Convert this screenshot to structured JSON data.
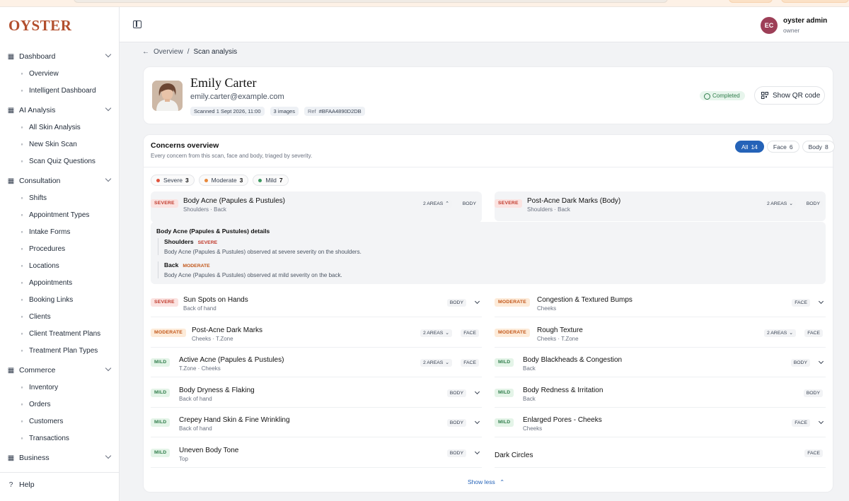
{
  "brand": {
    "logo": "OYSTER",
    "accent": "#b24f2e"
  },
  "sidebar": {
    "sections": [
      {
        "label": "Dashboard",
        "icon": "grid-icon",
        "items": [
          {
            "label": "Overview",
            "icon": "bar-chart-icon"
          },
          {
            "label": "Intelligent Dashboard",
            "icon": "circle-icon"
          }
        ]
      },
      {
        "label": "AI Analysis",
        "icon": "scan-icon",
        "items": [
          {
            "label": "All Skin Analysis",
            "icon": "scan-icon"
          },
          {
            "label": "New Skin Scan",
            "icon": "camera-icon"
          },
          {
            "label": "Scan Quiz Questions",
            "icon": "quiz-icon"
          }
        ]
      },
      {
        "label": "Consultation",
        "icon": "calendar-icon",
        "items": [
          {
            "label": "Shifts",
            "icon": "clock-icon"
          },
          {
            "label": "Appointment Types",
            "icon": "list-icon"
          },
          {
            "label": "Intake Forms",
            "icon": "form-icon"
          },
          {
            "label": "Procedures",
            "icon": "file-icon"
          },
          {
            "label": "Locations",
            "icon": "pin-icon"
          },
          {
            "label": "Appointments",
            "icon": "calendar-icon"
          },
          {
            "label": "Booking Links",
            "icon": "link-icon"
          },
          {
            "label": "Clients",
            "icon": "user-icon"
          },
          {
            "label": "Client Treatment Plans",
            "icon": "clipboard-icon"
          },
          {
            "label": "Treatment Plan Types",
            "icon": "list-icon"
          }
        ]
      },
      {
        "label": "Commerce",
        "icon": "cart-icon",
        "items": [
          {
            "label": "Inventory",
            "icon": "box-icon"
          },
          {
            "label": "Orders",
            "icon": "cart-icon"
          },
          {
            "label": "Customers",
            "icon": "users-icon"
          },
          {
            "label": "Transactions",
            "icon": "card-icon"
          }
        ]
      },
      {
        "label": "Business",
        "icon": "building-icon",
        "items": []
      }
    ],
    "help": "Help"
  },
  "header": {
    "avatar_initials": "EC",
    "user_name": "oyster admin",
    "user_role": "owner"
  },
  "breadcrumb": {
    "back": "Overview",
    "separator": "/",
    "current": "Scan analysis"
  },
  "patient": {
    "name": "Emily Carter",
    "email": "emily.carter@example.com",
    "scanned": "Scanned 1 Sept 2026, 11:00",
    "images": "3 images",
    "ref_label": "Ref",
    "ref": "#BFAA4890D2DB",
    "status": "Completed",
    "qr_button": "Show QR code"
  },
  "concerns": {
    "title": "Concerns overview",
    "subtitle": "Every concern from this scan, face and body, triaged by severity.",
    "tabs": [
      {
        "label": "All",
        "count": "14",
        "active": true
      },
      {
        "label": "Face",
        "count": "6",
        "active": false
      },
      {
        "label": "Body",
        "count": "8",
        "active": false
      }
    ],
    "filters": [
      {
        "label": "Severe",
        "count": "3",
        "color": "#e0533d"
      },
      {
        "label": "Moderate",
        "count": "3",
        "color": "#e8883a"
      },
      {
        "label": "Mild",
        "count": "7",
        "color": "#3c9a5f"
      }
    ],
    "rows": [
      {
        "badge": "SEVERE",
        "level": "severe",
        "name": "Body Acne (Papules & Pustules)",
        "sub": "Shoulders · Back",
        "areas": "2 AREAS",
        "tag": "BODY"
      },
      {
        "badge": "SEVERE",
        "level": "severe",
        "name": "Post-Acne Dark Marks (Body)",
        "sub": "Shoulders · Back",
        "areas": "2 AREAS",
        "tag": "BODY"
      },
      {
        "badge": "SEVERE",
        "level": "severe",
        "name": "Sun Spots on Hands",
        "sub": "Back of hand",
        "areas": "",
        "tag": "BODY"
      },
      {
        "badge": "MODERATE",
        "level": "moderate",
        "name": "Congestion & Textured Bumps",
        "sub": "Cheeks",
        "areas": "",
        "tag": "FACE"
      },
      {
        "badge": "MODERATE",
        "level": "moderate",
        "name": "Post-Acne Dark Marks",
        "sub": "Cheeks · T.Zone",
        "areas": "2 AREAS",
        "tag": "FACE"
      },
      {
        "badge": "MODERATE",
        "level": "moderate",
        "name": "Rough Texture",
        "sub": "Cheeks · T.Zone",
        "areas": "2 AREAS",
        "tag": "FACE"
      },
      {
        "badge": "MILD",
        "level": "mild",
        "name": "Active Acne (Papules & Pustules)",
        "sub": "T.Zone · Cheeks",
        "areas": "2 AREAS",
        "tag": "FACE"
      },
      {
        "badge": "MILD",
        "level": "mild",
        "name": "Body Blackheads & Congestion",
        "sub": "Back",
        "areas": "",
        "tag": "BODY"
      },
      {
        "badge": "MILD",
        "level": "mild",
        "name": "Body Dryness & Flaking",
        "sub": "Back of hand",
        "areas": "",
        "tag": "BODY"
      },
      {
        "badge": "MILD",
        "level": "mild",
        "name": "Body Redness & Irritation",
        "sub": "Back",
        "areas": "",
        "tag": "BODY"
      },
      {
        "badge": "MILD",
        "level": "mild",
        "name": "Crepey Hand Skin & Fine Wrinkling",
        "sub": "Back of hand",
        "areas": "",
        "tag": "BODY"
      },
      {
        "badge": "MILD",
        "level": "mild",
        "name": "Enlarged Pores - Cheeks",
        "sub": "Cheeks",
        "areas": "",
        "tag": "FACE"
      },
      {
        "badge": "MILD",
        "level": "mild",
        "name": "Uneven Body Tone",
        "sub": "Top",
        "areas": "",
        "tag": "BODY"
      },
      {
        "badge": "",
        "level": "",
        "name": "Dark Circles",
        "sub": "",
        "areas": "",
        "tag": "FACE"
      }
    ],
    "details": {
      "title": "Body Acne (Papules & Pustules) details",
      "areas": [
        {
          "name": "Shoulders",
          "level": "SEVERE",
          "text": "Body Acne (Papules & Pustules) observed at severe severity on the shoulders."
        },
        {
          "name": "Back",
          "level": "MODERATE",
          "text": "Body Acne (Papules & Pustules) observed at mild severity on the back."
        }
      ]
    },
    "show_less": "Show less"
  }
}
